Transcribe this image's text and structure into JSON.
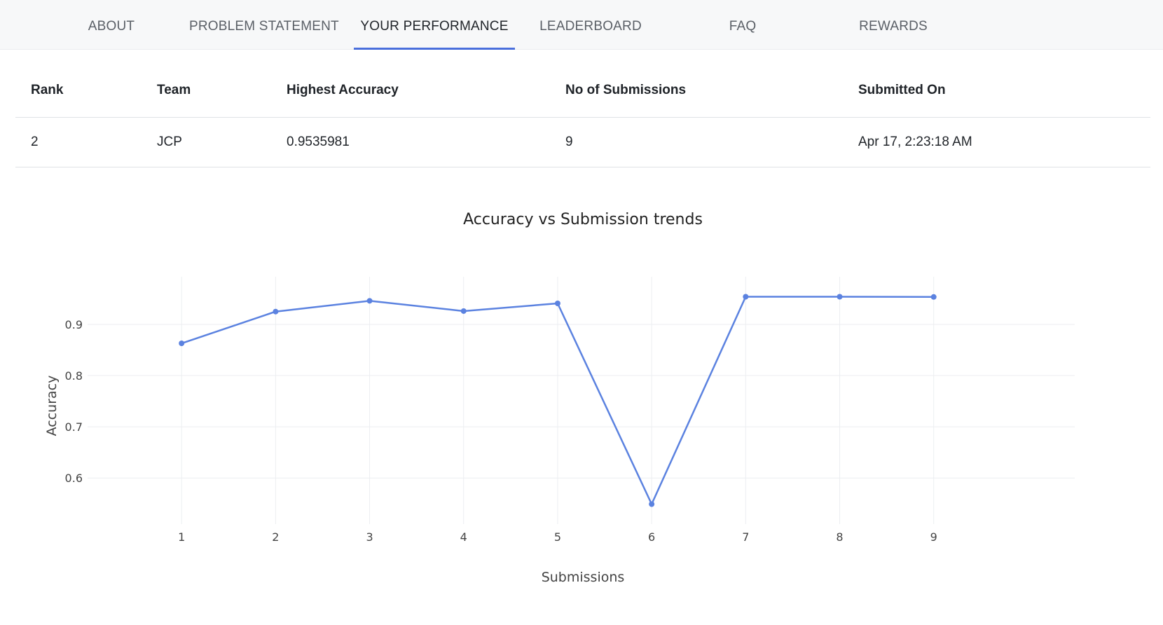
{
  "tabs": [
    {
      "label": "ABOUT",
      "active": false
    },
    {
      "label": "PROBLEM STATEMENT",
      "active": false
    },
    {
      "label": "YOUR PERFORMANCE",
      "active": true
    },
    {
      "label": "LEADERBOARD",
      "active": false
    },
    {
      "label": "FAQ",
      "active": false
    },
    {
      "label": "REWARDS",
      "active": false
    }
  ],
  "table": {
    "headers": {
      "rank": "Rank",
      "team": "Team",
      "accuracy": "Highest Accuracy",
      "submissions": "No of Submissions",
      "submitted_on": "Submitted On"
    },
    "row": {
      "rank": "2",
      "team": "JCP",
      "accuracy": "0.9535981",
      "submissions": "9",
      "submitted_on": "Apr 17, 2:23:18 AM"
    }
  },
  "colors": {
    "accent": "#4a6fdc",
    "series": "#5b82e0",
    "grid": "#eceef1"
  },
  "chart_data": {
    "type": "line",
    "title": "Accuracy vs Submission trends",
    "xlabel": "Submissions",
    "ylabel": "Accuracy",
    "x": [
      1,
      2,
      3,
      4,
      5,
      6,
      7,
      8,
      9
    ],
    "series": [
      {
        "values": [
          0.863,
          0.925,
          0.946,
          0.926,
          0.941,
          0.549,
          0.954,
          0.954,
          0.9536
        ]
      }
    ],
    "yticks": [
      0.6,
      0.7,
      0.8,
      0.9
    ],
    "ylim": [
      0.51,
      0.993
    ],
    "xlim": [
      0,
      10.5
    ],
    "grid": true
  }
}
